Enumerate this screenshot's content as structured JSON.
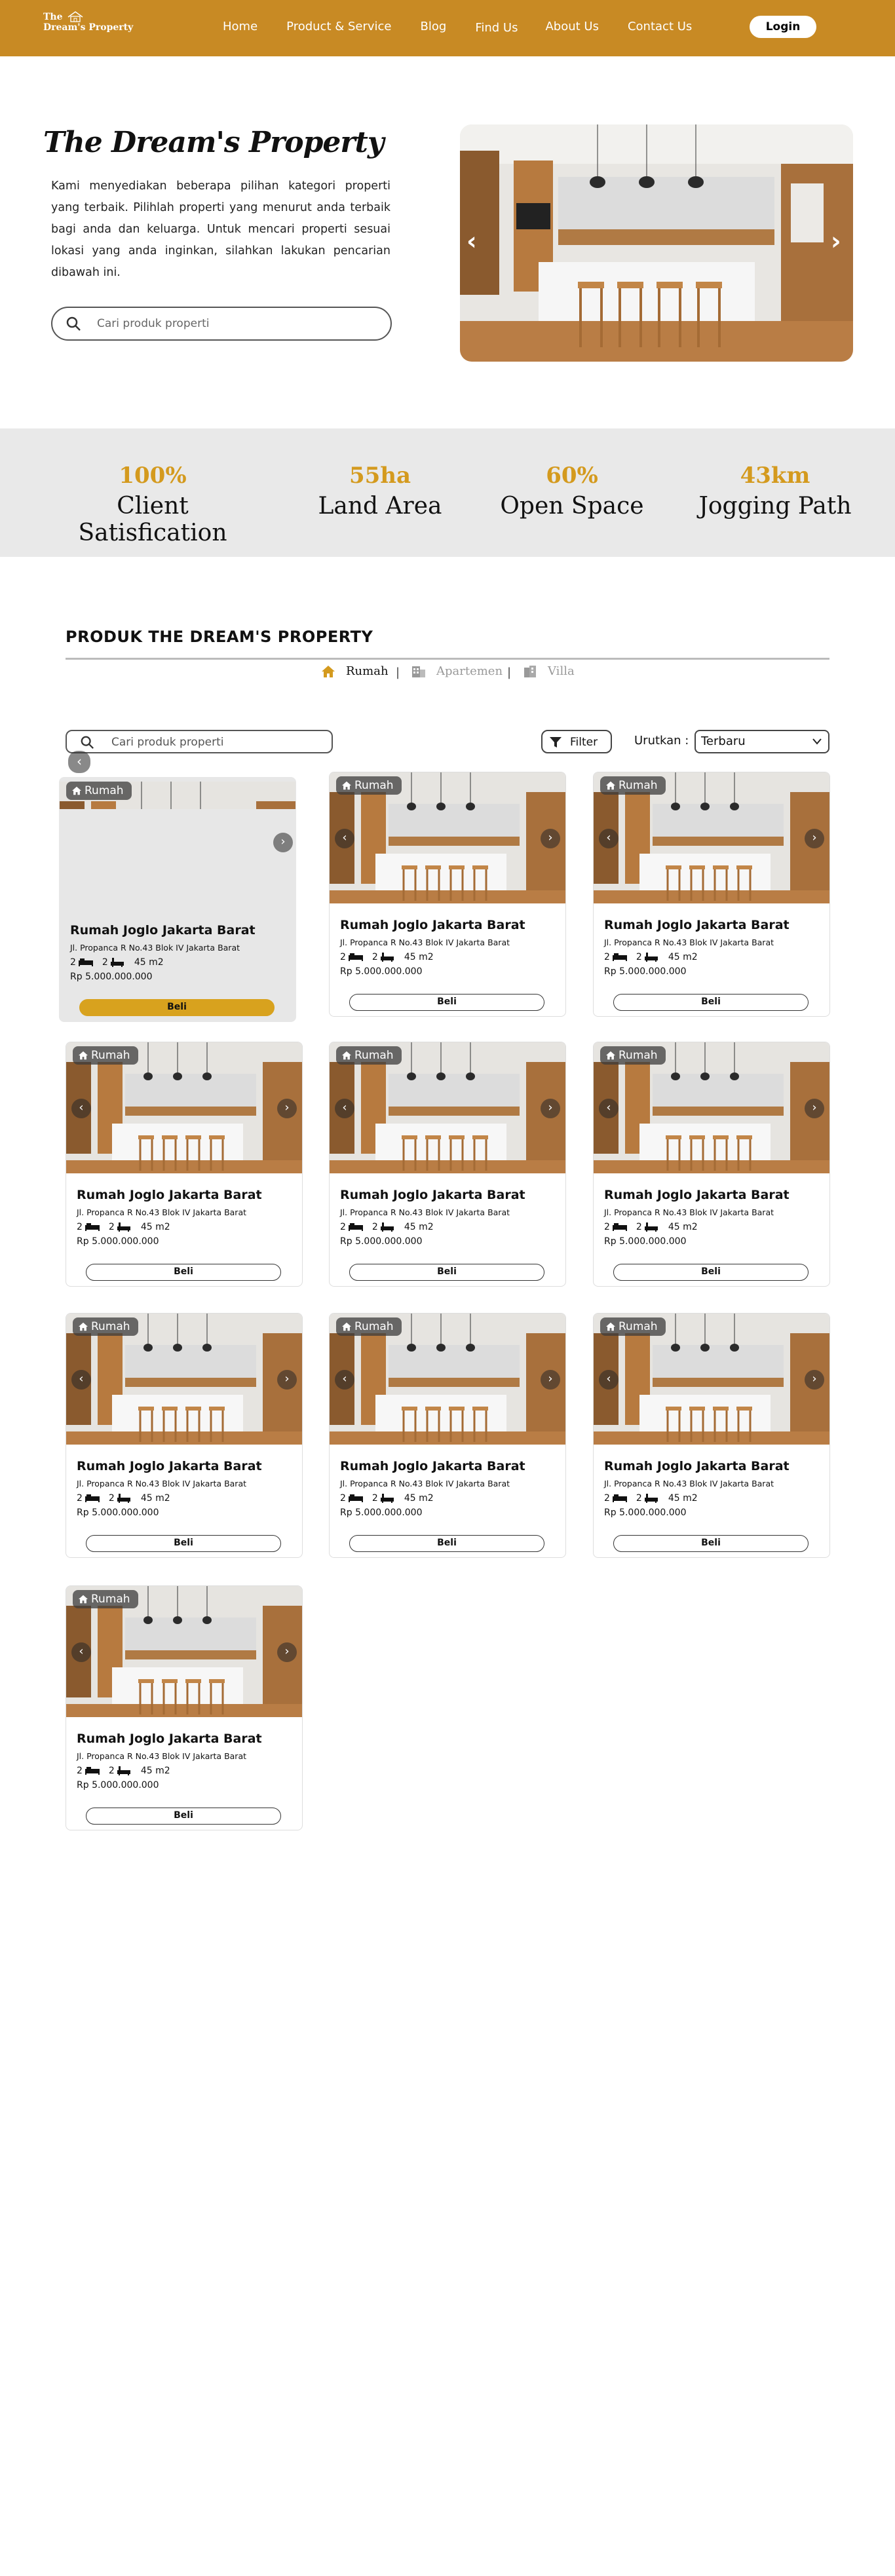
{
  "nav": {
    "logo_line1": "The",
    "logo_line2": "Dream's Property",
    "links": [
      "Home",
      "Product & Service",
      "Blog",
      "Find Us",
      "About Us",
      "Contact Us"
    ],
    "login": "Login"
  },
  "hero": {
    "title": "The Dream's Property",
    "description": "Kami menyediakan beberapa pilihan kategori properti yang terbaik. Pilihlah properti yang menurut anda terbaik bagi anda dan keluarga.  Untuk mencari properti sesuai lokasi yang anda inginkan, silahkan lakukan pencarian dibawah ini.",
    "search_placeholder": "Cari produk properti"
  },
  "stats": [
    {
      "value": "100%",
      "label": "Client Satisfication"
    },
    {
      "value": "55ha",
      "label": "Land Area"
    },
    {
      "value": "60%",
      "label": "Open Space"
    },
    {
      "value": "43km",
      "label": "Jogging Path"
    }
  ],
  "products": {
    "title": "PRODUK THE DREAM'S PROPERTY",
    "categories": [
      "Rumah",
      "Apartemen",
      "Villa"
    ],
    "search_placeholder": "Cari produk properti",
    "filter_label": "Filter",
    "sort_label": "Urutkan :",
    "sort_value": "Terbaru",
    "card": {
      "badge": "Rumah",
      "title": "Rumah Joglo Jakarta Barat",
      "address": "Jl. Propanca R No.43 Blok IV Jakarta Barat",
      "beds": "2",
      "baths": "2",
      "area": "45 m2",
      "price": "Rp 5.000.000.000",
      "buy": "Beli"
    }
  },
  "colors": {
    "brand": "#c88a24",
    "accent": "#d49a1e",
    "buy_active": "#d8a21e"
  }
}
